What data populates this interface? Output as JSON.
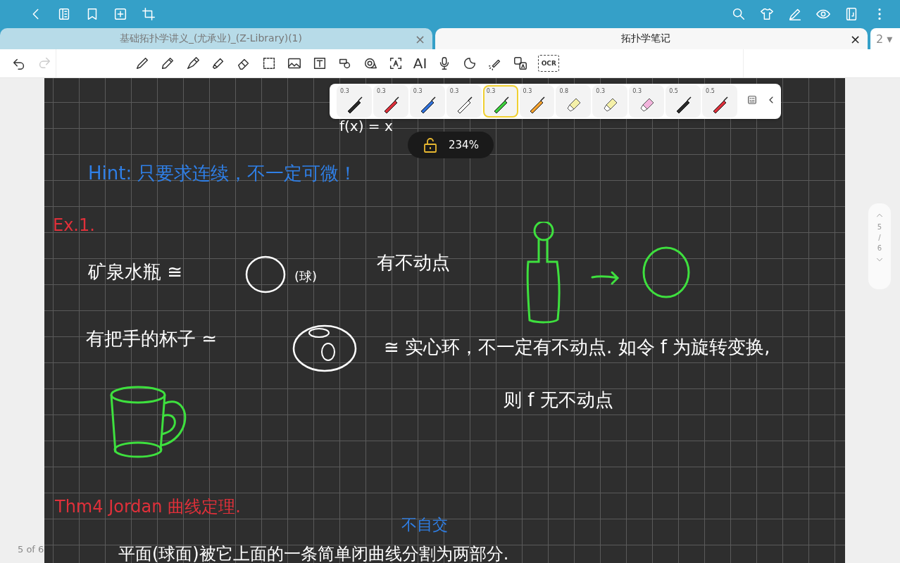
{
  "tabs": [
    {
      "title": "基础拓扑学讲义_(尤承业)_(Z-Library)(1)",
      "close": "×",
      "selected": false
    },
    {
      "title": "拓扑学笔记",
      "close": "×",
      "selected": true
    }
  ],
  "tab_count": "2",
  "tab_menu": "▾",
  "toolbar": {
    "ai_label": "AI",
    "ocr_label": "OCR"
  },
  "pens": [
    {
      "size": "0.3",
      "kind": "pen",
      "color": "#2a2a2a",
      "selected": false
    },
    {
      "size": "0.3",
      "kind": "pen",
      "color": "#d9303a",
      "selected": false
    },
    {
      "size": "0.3",
      "kind": "pen",
      "color": "#2f6fd6",
      "selected": false
    },
    {
      "size": "0.3",
      "kind": "pen",
      "color": "#ffffff",
      "selected": false
    },
    {
      "size": "0.3",
      "kind": "pen",
      "color": "#3ccc3c",
      "selected": true
    },
    {
      "size": "0.3",
      "kind": "pen",
      "color": "#f0a030",
      "selected": false
    },
    {
      "size": "0.8",
      "kind": "highlighter",
      "color": "#f4f0a8",
      "selected": false
    },
    {
      "size": "0.3",
      "kind": "highlighter",
      "color": "#f4f0a8",
      "selected": false
    },
    {
      "size": "0.3",
      "kind": "highlighter",
      "color": "#f2b4dc",
      "selected": false
    },
    {
      "size": "0.5",
      "kind": "pen",
      "color": "#2a2a2a",
      "selected": false
    },
    {
      "size": "0.5",
      "kind": "pen",
      "color": "#d9303a",
      "selected": false
    }
  ],
  "zoom": {
    "value": "234%",
    "locked": false
  },
  "notes": [
    {
      "text": "f(x) = x",
      "color": "#ffffff"
    },
    {
      "text": "Hint: 只要求连续，不一定可微！",
      "color": "#2f7fe6"
    },
    {
      "text": "Ex.1.",
      "color": "#e0303a"
    },
    {
      "text": "矿泉水瓶 ≅",
      "color": "#ffffff"
    },
    {
      "text": "(球)",
      "color": "#ffffff"
    },
    {
      "text": "有不动点",
      "color": "#ffffff"
    },
    {
      "text": "有把手的杯子 ≃",
      "color": "#ffffff"
    },
    {
      "text": "≅ 实心环，不一定有不动点. 如令 f 为旋转变换,",
      "color": "#ffffff"
    },
    {
      "text": "则 f 无不动点",
      "color": "#ffffff"
    },
    {
      "text": "Thm4 Jordan 曲线定理.",
      "color": "#e0303a"
    },
    {
      "text": "不自交",
      "color": "#2f7fe6"
    },
    {
      "text": "平面(球面)被它上面的一条简单闭曲线分割为两部分.",
      "color": "#ffffff"
    }
  ],
  "page_nav": {
    "current": "5",
    "separator": "/",
    "total": "6"
  },
  "page_label": "5 of 6"
}
